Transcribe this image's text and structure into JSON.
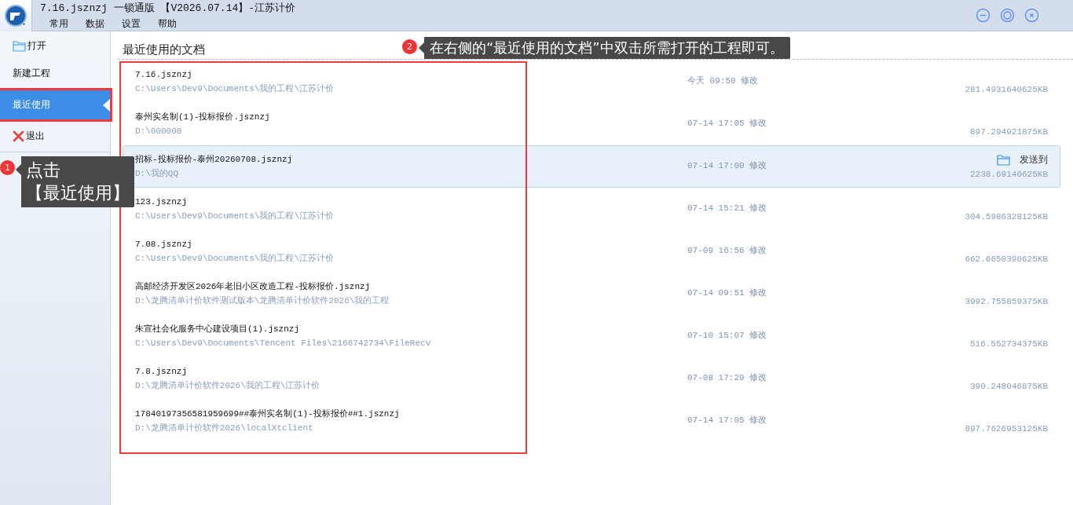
{
  "window": {
    "title": "7.16.jsznzj 一锁通版 【V2026.07.14】-江苏计价"
  },
  "menu": [
    "常用",
    "数据",
    "设置",
    "帮助"
  ],
  "sidebar": {
    "items": [
      {
        "label": "打开",
        "kind": "open",
        "selected": false,
        "highlighted": false
      },
      {
        "label": "新建工程",
        "kind": "plain",
        "selected": false,
        "highlighted": false
      },
      {
        "label": "最近使用",
        "kind": "plain",
        "selected": true,
        "highlighted": true
      },
      {
        "label": "退出",
        "kind": "exit",
        "selected": false,
        "highlighted": false
      }
    ]
  },
  "recent_documents": {
    "title": "最近使用的文档",
    "highlighted": true,
    "send_button": "发送到",
    "rows": [
      {
        "name": "7.16.jsznzj",
        "path": "C:\\Users\\Dev9\\Documents\\我的工程\\江苏计价",
        "modified": "今天 09:50 修改",
        "size": "281.4931640625KB",
        "selected": false
      },
      {
        "name": "泰州实名制(1)-投标报价.jsznzj",
        "path": "D:\\000000",
        "modified": "07-14 17:05 修改",
        "size": "897.294921875KB",
        "selected": false
      },
      {
        "name": "招标-投标报价-泰州20260708.jsznzj",
        "path": "D:\\我的QQ",
        "modified": "07-14 17:00 修改",
        "size": "2238.69140625KB",
        "selected": true
      },
      {
        "name": "123.jsznzj",
        "path": "C:\\Users\\Dev9\\Documents\\我的工程\\江苏计价",
        "modified": "07-14 15:21 修改",
        "size": "304.5986328125KB",
        "selected": false
      },
      {
        "name": "7.08.jsznzj",
        "path": "C:\\Users\\Dev9\\Documents\\我的工程\\江苏计价",
        "modified": "07-09 16:56 修改",
        "size": "662.6650390625KB",
        "selected": false
      },
      {
        "name": "高邮经济开发区2026年老旧小区改造工程-投标报价.jsznzj",
        "path": "D:\\龙腾清单计价软件测试版本\\龙腾清单计价软件2026\\我的工程",
        "modified": "07-14 09:51 修改",
        "size": "3992.755859375KB",
        "selected": false
      },
      {
        "name": "朱宣社会化服务中心建设项目(1).jsznzj",
        "path": "C:\\Users\\Dev9\\Documents\\Tencent Files\\2166742734\\FileRecv",
        "modified": "07-10 15:07 修改",
        "size": "516.552734375KB",
        "selected": false
      },
      {
        "name": "7.8.jsznzj",
        "path": "D:\\龙腾清单计价软件2026\\我的工程\\江苏计价",
        "modified": "07-08 17:29 修改",
        "size": "390.248046875KB",
        "selected": false
      },
      {
        "name": "17840197356581959699##泰州实名制(1)-投标报价##1.jsznzj",
        "path": "D:\\龙腾清单计价软件2026\\localXtclient",
        "modified": "07-14 17:05 修改",
        "size": "897.7626953125KB",
        "selected": false
      }
    ]
  },
  "callouts": [
    {
      "badge": "1",
      "lines": [
        "点击",
        "【最近使用】"
      ]
    },
    {
      "badge": "2",
      "lines": [
        "在右侧的“最近使用的文档”中双击所需打开的工程即可。"
      ]
    }
  ]
}
